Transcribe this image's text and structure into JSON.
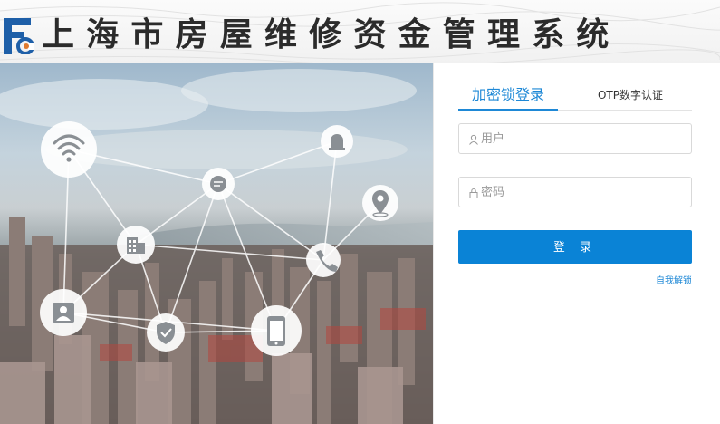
{
  "header": {
    "title": "上海市房屋维修资金管理系统",
    "logo_icon": "fc-logo-icon",
    "logo_colors": {
      "primary": "#1e5fa8",
      "accent": "#e07a2e"
    }
  },
  "hero": {
    "icons": [
      "wifi-icon",
      "chat-icon",
      "alarm-light-icon",
      "location-pin-icon",
      "building-icon",
      "phone-icon",
      "id-card-icon",
      "shield-icon",
      "smartphone-icon"
    ]
  },
  "login": {
    "tabs": [
      {
        "label": "加密锁登录",
        "active": true
      },
      {
        "label": "OTP数字认证",
        "active": false
      }
    ],
    "username": {
      "placeholder": "用户",
      "value": "",
      "icon": "user-icon"
    },
    "password": {
      "placeholder": "密码",
      "value": "",
      "icon": "lock-icon"
    },
    "submit_label": "登 录",
    "self_unlock_label": "自我解锁",
    "accent_color": "#0a83d6"
  }
}
